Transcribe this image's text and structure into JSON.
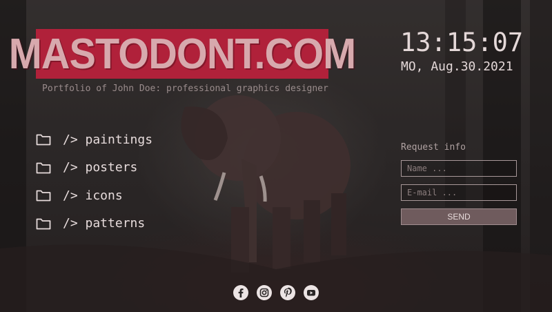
{
  "site": {
    "logo": "MASTODONT.COM",
    "subtitle": "Portfolio of John Doe: professional graphics designer"
  },
  "clock": {
    "time": "13:15:07",
    "date": "MO, Aug.30.2021"
  },
  "menu": {
    "items": [
      {
        "label": "/> paintings",
        "icon": "folder-icon"
      },
      {
        "label": "/> posters",
        "icon": "folder-icon"
      },
      {
        "label": "/> icons",
        "icon": "folder-icon"
      },
      {
        "label": "/> patterns",
        "icon": "folder-icon"
      }
    ]
  },
  "form": {
    "title": "Request info",
    "name_placeholder": "Name ...",
    "email_placeholder": "E-mail ...",
    "send_label": "SEND"
  },
  "social": {
    "icons": [
      "facebook-icon",
      "instagram-icon",
      "pinterest-icon",
      "youtube-icon"
    ]
  },
  "colors": {
    "logo_bg": "#b0213a",
    "logo_text": "#d7a9ad",
    "text": "#e7dcdc",
    "button_bg": "#6f5b5d"
  }
}
